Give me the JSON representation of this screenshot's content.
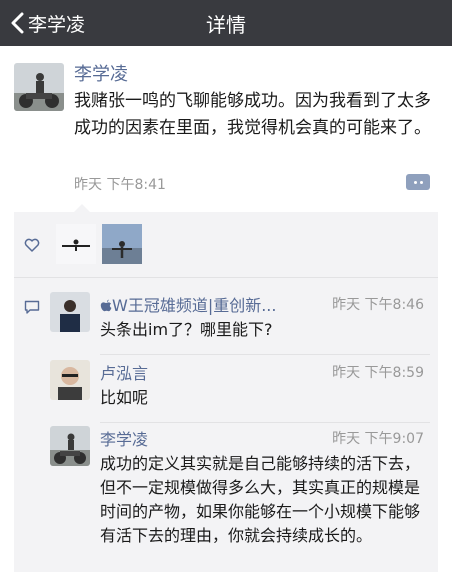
{
  "nav": {
    "back_label": "李学凌",
    "title": "详情"
  },
  "post": {
    "author": "李学凌",
    "text": "我赌张一鸣的飞聊能够成功。因为我看到了太多成功的因素在里面，我觉得机会真的可能来了。",
    "time": "昨天 下午8:41"
  },
  "comments": [
    {
      "author": "W王冠雄频道|重创新...",
      "time": "昨天 下午8:46",
      "text": "头条出im了？哪里能下?"
    },
    {
      "author": "卢泓言",
      "time": "昨天 下午8:59",
      "text": "比如呢"
    },
    {
      "author": "李学凌",
      "time": "昨天 下午9:07",
      "text": "成功的定义其实就是自己能够持续的活下去，但不一定规模做得多么大，其实真正的规模是时间的产物，如果你能够在一个小规模下能够有活下去的理由，你就会持续成长的。"
    }
  ],
  "icons": {
    "back": "chevron-left-icon",
    "more": "more-dots-icon",
    "like": "heart-icon",
    "comment": "comment-icon",
    "apple": "apple-icon"
  },
  "colors": {
    "navbar": "#393a3f",
    "name_link": "#576b95",
    "comment_bg": "#f3f3f5",
    "timestamp": "#999999"
  }
}
